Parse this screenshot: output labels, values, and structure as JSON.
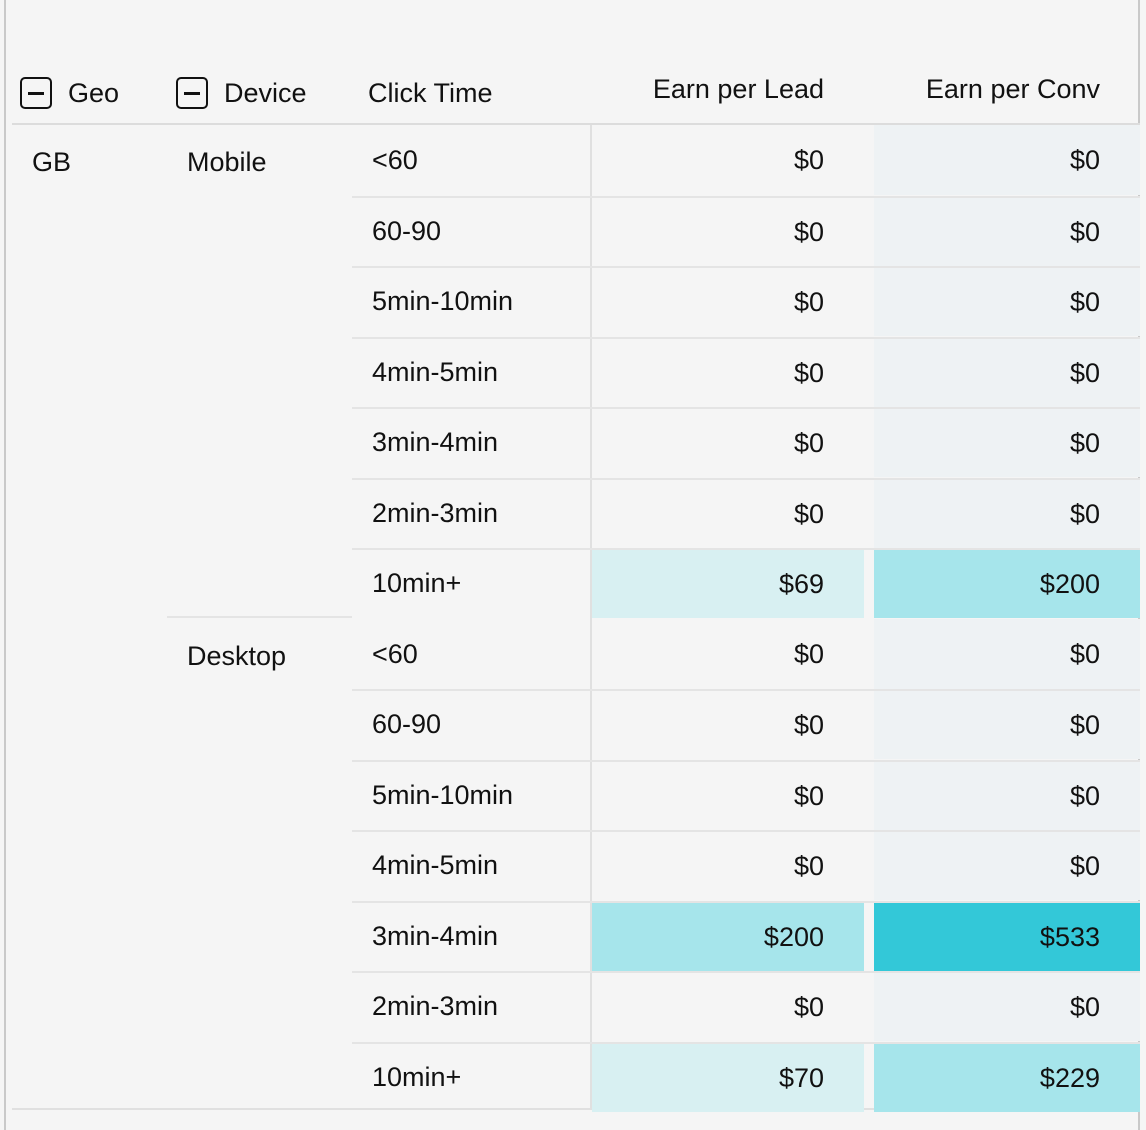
{
  "header": {
    "geo_label": "Geo",
    "device_label": "Device",
    "click_time_label": "Click Time",
    "earn_per_lead_label": "Earn per Lead",
    "earn_per_conv_label": "Earn per Conv"
  },
  "geo": "GB",
  "colors": {
    "neutral_lead": "#f5f5f5",
    "neutral_conv": "#eef2f4",
    "light": "#d8f0f2",
    "medium": "#a6e5eb",
    "dark": "#33c8d8"
  },
  "devices": [
    {
      "name": "Mobile",
      "rows": [
        {
          "click": "<60",
          "lead": "$0",
          "conv": "$0"
        },
        {
          "click": "60-90",
          "lead": "$0",
          "conv": "$0"
        },
        {
          "click": "5min-10min",
          "lead": "$0",
          "conv": "$0"
        },
        {
          "click": "4min-5min",
          "lead": "$0",
          "conv": "$0"
        },
        {
          "click": "3min-4min",
          "lead": "$0",
          "conv": "$0"
        },
        {
          "click": "2min-3min",
          "lead": "$0",
          "conv": "$0"
        },
        {
          "click": "10min+",
          "lead": "$69",
          "conv": "$200"
        }
      ]
    },
    {
      "name": "Desktop",
      "rows": [
        {
          "click": "<60",
          "lead": "$0",
          "conv": "$0"
        },
        {
          "click": "60-90",
          "lead": "$0",
          "conv": "$0"
        },
        {
          "click": "5min-10min",
          "lead": "$0",
          "conv": "$0"
        },
        {
          "click": "4min-5min",
          "lead": "$0",
          "conv": "$0"
        },
        {
          "click": "3min-4min",
          "lead": "$200",
          "conv": "$533"
        },
        {
          "click": "2min-3min",
          "lead": "$0",
          "conv": "$0"
        },
        {
          "click": "10min+",
          "lead": "$70",
          "conv": "$229"
        }
      ]
    }
  ]
}
